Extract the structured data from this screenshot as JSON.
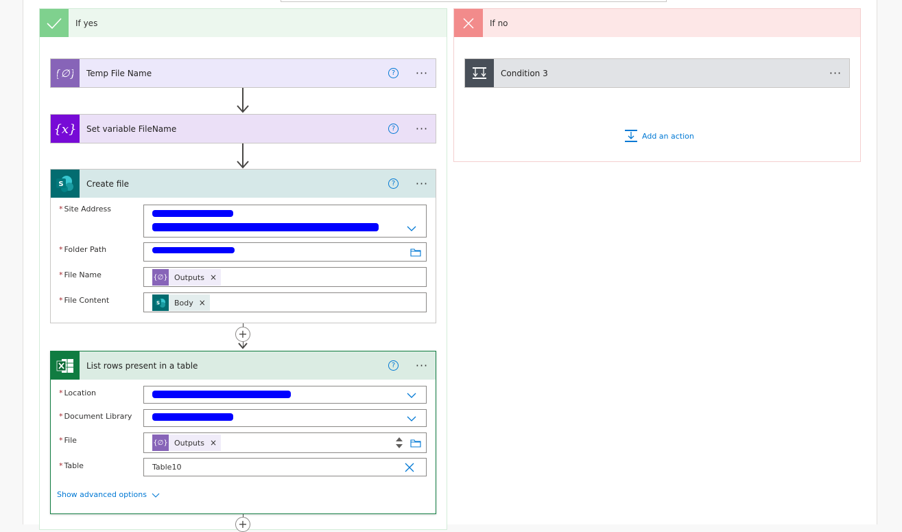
{
  "branches": {
    "yes": {
      "title": "If yes"
    },
    "no": {
      "title": "If no"
    }
  },
  "cards": {
    "temp_file_name": {
      "title": "Temp File Name",
      "help": "?",
      "more": "···"
    },
    "set_variable": {
      "title": "Set variable FileName",
      "help": "?",
      "more": "···"
    },
    "create_file": {
      "title": "Create file",
      "help": "?",
      "more": "···",
      "fields": {
        "site_address": {
          "label": "Site Address"
        },
        "folder_path": {
          "label": "Folder Path"
        },
        "file_name": {
          "label": "File Name",
          "token": "Outputs"
        },
        "file_content": {
          "label": "File Content",
          "token": "Body"
        }
      }
    },
    "list_rows": {
      "title": "List rows present in a table",
      "help": "?",
      "more": "···",
      "fields": {
        "location": {
          "label": "Location"
        },
        "document_library": {
          "label": "Document Library"
        },
        "file": {
          "label": "File",
          "token": "Outputs"
        },
        "table": {
          "label": "Table",
          "value": "Table10"
        }
      },
      "advanced_link": "Show advanced options"
    },
    "condition_3": {
      "title": "Condition 3",
      "more": "···"
    }
  },
  "add_action": {
    "label": "Add an action"
  },
  "required_marker": "*",
  "token_remove": "×",
  "icons": {
    "branch_yes": "check-icon",
    "branch_no": "close-icon",
    "variable_color": "#8764b8",
    "variable_set_color": "#770bd6",
    "sharepoint_color": "#036c70",
    "excel_color": "#107c41",
    "condition_color": "#484f58"
  },
  "colors": {
    "accent": "#0078d4",
    "yes_header": "#ecf7ee",
    "no_header": "#fde7e7",
    "redaction": "#0000ff"
  }
}
